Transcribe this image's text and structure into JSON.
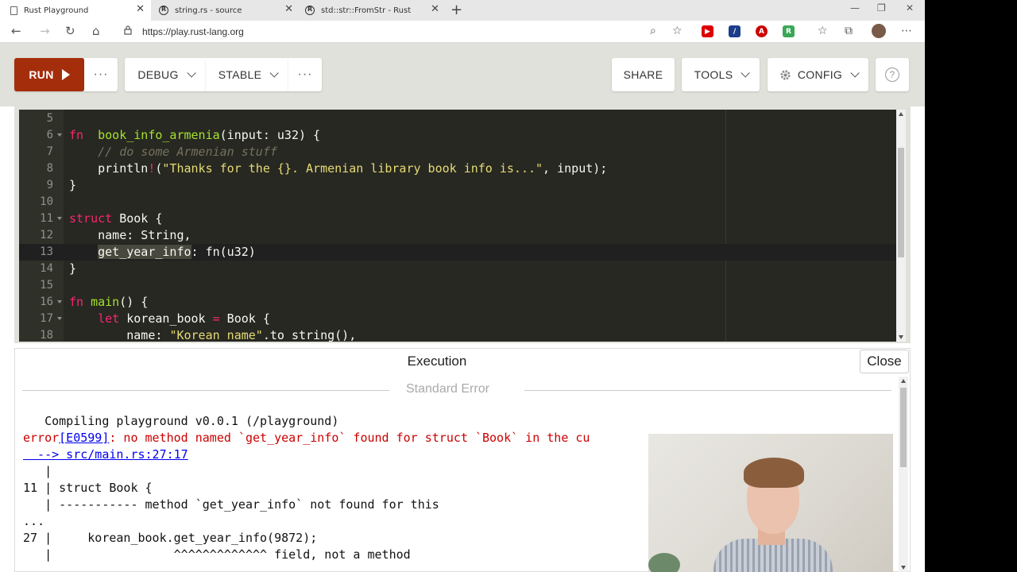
{
  "browser": {
    "tabs": [
      {
        "title": "Rust Playground",
        "active": true
      },
      {
        "title": "string.rs - source",
        "active": false
      },
      {
        "title": "std::str::FromStr - Rust",
        "active": false
      }
    ],
    "url": "https://play.rust-lang.org"
  },
  "toolbar": {
    "run": "RUN",
    "more": "···",
    "mode": "DEBUG",
    "channel": "STABLE",
    "share": "SHARE",
    "tools": "TOOLS",
    "config": "CONFIG",
    "help": "?"
  },
  "editor": {
    "lines": [
      {
        "n": "5",
        "tokens": []
      },
      {
        "n": "6",
        "fold": true,
        "tokens": [
          [
            "kw",
            "fn"
          ],
          [
            "",
            "  "
          ],
          [
            "fn",
            "book_info_armenia"
          ],
          [
            "",
            "(input: u32) {"
          ]
        ]
      },
      {
        "n": "7",
        "tokens": [
          [
            "",
            "    "
          ],
          [
            "cm",
            "// do some Armenian stuff"
          ]
        ]
      },
      {
        "n": "8",
        "tokens": [
          [
            "",
            "    println"
          ],
          [
            "kw",
            "!"
          ],
          [
            "",
            "("
          ],
          [
            "str",
            "\"Thanks for the {}. Armenian library book info is...\""
          ],
          [
            "",
            ", input);"
          ]
        ]
      },
      {
        "n": "9",
        "tokens": [
          [
            "",
            "}"
          ]
        ]
      },
      {
        "n": "10",
        "tokens": []
      },
      {
        "n": "11",
        "fold": true,
        "tokens": [
          [
            "kw",
            "struct"
          ],
          [
            "",
            " Book {"
          ]
        ]
      },
      {
        "n": "12",
        "tokens": [
          [
            "",
            "    name: String,"
          ]
        ]
      },
      {
        "n": "13",
        "active": true,
        "tokens": [
          [
            "",
            "    "
          ],
          [
            "sel",
            "get_year_info"
          ],
          [
            "",
            ": fn(u32)"
          ]
        ]
      },
      {
        "n": "14",
        "tokens": [
          [
            "",
            "}"
          ]
        ]
      },
      {
        "n": "15",
        "tokens": []
      },
      {
        "n": "16",
        "fold": true,
        "tokens": [
          [
            "kw",
            "fn"
          ],
          [
            "",
            " "
          ],
          [
            "fn",
            "main"
          ],
          [
            "",
            "() {"
          ]
        ]
      },
      {
        "n": "17",
        "fold": true,
        "tokens": [
          [
            "",
            "    "
          ],
          [
            "kw",
            "let"
          ],
          [
            "",
            " korean_book "
          ],
          [
            "kw",
            "="
          ],
          [
            "",
            " Book {"
          ]
        ]
      },
      {
        "n": "18",
        "tokens": [
          [
            "",
            "        name: "
          ],
          [
            "str",
            "\"Korean name\""
          ],
          [
            "",
            ".to_string(),"
          ]
        ]
      }
    ]
  },
  "output": {
    "title": "Execution",
    "close": "Close",
    "stderr_label": "Standard Error",
    "lines": [
      [
        [
          "",
          "   Compiling playground v0.0.1 (/playground)"
        ]
      ],
      [
        [
          "err",
          "error"
        ],
        [
          "link",
          "[E0599]"
        ],
        [
          "err",
          ": no method named `get_year_info` found for struct `Book` in the cu"
        ]
      ],
      [
        [
          "link",
          "  --> src/main.rs:27:17"
        ]
      ],
      [
        [
          "",
          "   |"
        ]
      ],
      [
        [
          "",
          "11 | struct Book {"
        ]
      ],
      [
        [
          "",
          "   | ----------- method `get_year_info` not found for this"
        ]
      ],
      [
        [
          "",
          "..."
        ]
      ],
      [
        [
          "",
          "27 |     korean_book.get_year_info(9872);"
        ]
      ],
      [
        [
          "",
          "   |                 ^^^^^^^^^^^^^ field, not a method"
        ]
      ]
    ]
  }
}
